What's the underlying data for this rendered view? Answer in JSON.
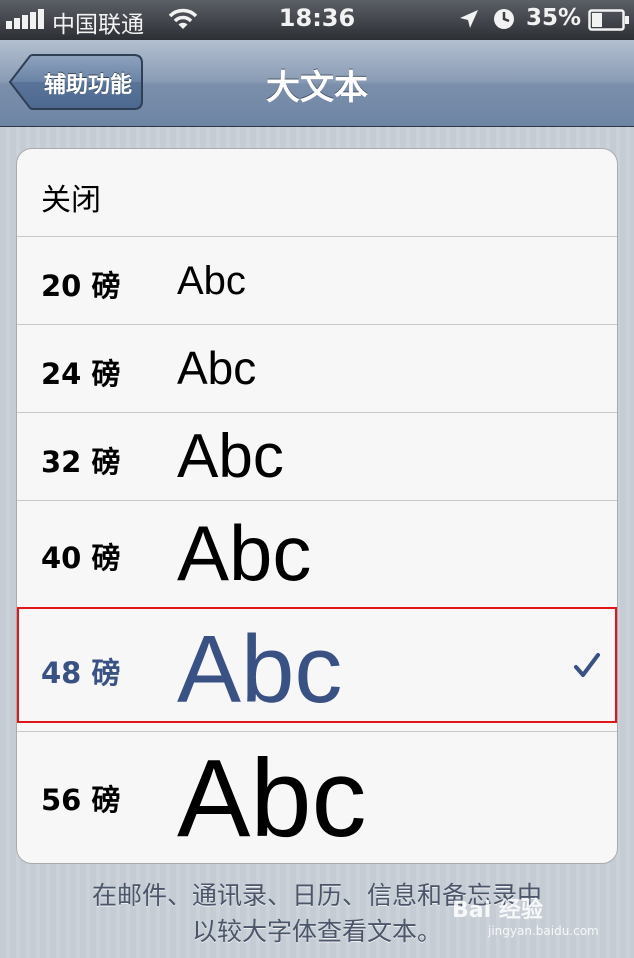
{
  "status_bar": {
    "carrier": "中国联通",
    "time": "18:36",
    "battery_percent": "35%",
    "battery_level": 0.35,
    "signal_bars": 5,
    "icons": [
      "signal-icon",
      "wifi-icon",
      "location-icon",
      "alarm-icon",
      "battery-icon"
    ]
  },
  "nav": {
    "back_label": "辅助功能",
    "title": "大文本"
  },
  "options": [
    {
      "label": "关闭",
      "sample": "",
      "selected": false
    },
    {
      "label": "20 磅",
      "sample": "Abc",
      "selected": false
    },
    {
      "label": "24 磅",
      "sample": "Abc",
      "selected": false
    },
    {
      "label": "32 磅",
      "sample": "Abc",
      "selected": false
    },
    {
      "label": "40 磅",
      "sample": "Abc",
      "selected": false
    },
    {
      "label": "48 磅",
      "sample": "Abc",
      "selected": true
    },
    {
      "label": "56 磅",
      "sample": "Abc",
      "selected": false
    }
  ],
  "footer": {
    "line1": "在邮件、通讯录、日历、信息和备忘录中",
    "line2": "以较大字体查看文本。"
  },
  "watermark": {
    "main": "Bai 经验",
    "sub": "jingyan.baidu.com"
  },
  "colors": {
    "selected_text": "#3a5183",
    "highlight_border": "#e0161b",
    "nav_bar": "#7b8fab"
  }
}
